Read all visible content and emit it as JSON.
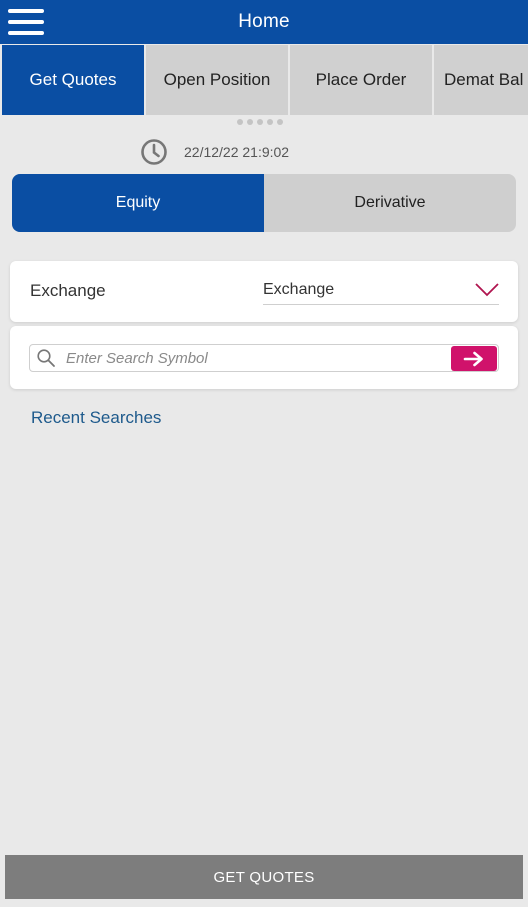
{
  "header": {
    "title": "Home",
    "menu_icon": "hamburger-menu-icon"
  },
  "tabs": [
    {
      "label": "Get Quotes",
      "active": true
    },
    {
      "label": "Open Position"
    },
    {
      "label": "Place Order"
    },
    {
      "label": "Demat Bal"
    }
  ],
  "timestamp": {
    "icon": "clock-icon",
    "value": "22/12/22 21:9:02"
  },
  "segment": [
    {
      "label": "Equity",
      "active": true
    },
    {
      "label": "Derivative"
    }
  ],
  "exchange": {
    "label": "Exchange",
    "selected": "Exchange",
    "icon": "chevron-down-icon"
  },
  "search": {
    "placeholder": "Enter Search Symbol",
    "value": "",
    "icon": "search-icon",
    "go_icon": "arrow-right-icon"
  },
  "recent": {
    "label": "Recent Searches"
  },
  "bottom": {
    "button_label": "GET QUOTES"
  },
  "colors": {
    "primary": "#0a4ea3",
    "accent": "#d0126b",
    "tab_inactive": "#d0d0d0",
    "bottom_button": "#7d7d7d",
    "link": "#1e5a8c"
  }
}
